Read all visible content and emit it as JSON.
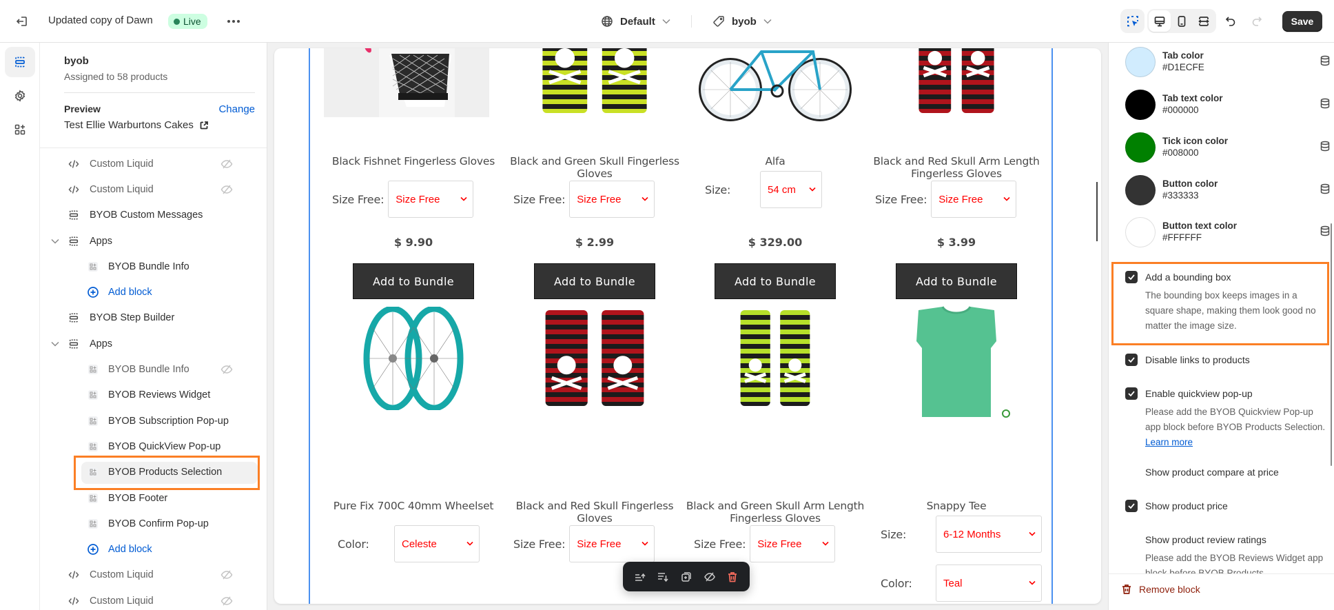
{
  "topbar": {
    "theme_name": "Updated copy of Dawn",
    "status_badge": "Live",
    "locale": "Default",
    "template": "byob",
    "save_label": "Save",
    "icons": [
      "exit-icon",
      "more-icon",
      "globe-icon",
      "tag-icon",
      "inspector-icon",
      "desktop-icon",
      "mobile-icon",
      "fullwidth-icon",
      "undo-icon",
      "redo-icon"
    ]
  },
  "rail": {
    "items": [
      {
        "name": "sections",
        "icon": "sections-icon",
        "active": true
      },
      {
        "name": "theme-settings",
        "icon": "gear-icon",
        "active": false
      },
      {
        "name": "app-embeds",
        "icon": "apps-icon",
        "active": false
      }
    ]
  },
  "sidebar": {
    "template_name": "byob",
    "assigned": "Assigned to 58 products",
    "preview_label": "Preview",
    "change_label": "Change",
    "preview_value": "Test Ellie Warburtons Cakes",
    "tree": [
      {
        "label": "Custom Liquid",
        "type": "liquid",
        "level": 0,
        "hidden": true
      },
      {
        "label": "Custom Liquid",
        "type": "liquid",
        "level": 0,
        "hidden": true
      },
      {
        "label": "BYOB Custom Messages",
        "type": "section",
        "level": 0,
        "hidden": false
      },
      {
        "label": "Apps",
        "type": "group",
        "level": 0,
        "expanded": true
      },
      {
        "label": "BYOB Bundle Info",
        "type": "app",
        "level": 1,
        "hidden": false
      },
      {
        "label": "Add block",
        "type": "add",
        "level": 1
      },
      {
        "label": "BYOB Step Builder",
        "type": "section",
        "level": 0,
        "hidden": false
      },
      {
        "label": "Apps",
        "type": "group",
        "level": 0,
        "expanded": true
      },
      {
        "label": "BYOB Bundle Info",
        "type": "app",
        "level": 1,
        "hidden": true
      },
      {
        "label": "BYOB Reviews Widget",
        "type": "app",
        "level": 1,
        "hidden": false
      },
      {
        "label": "BYOB Subscription Pop-up",
        "type": "app",
        "level": 1,
        "hidden": false
      },
      {
        "label": "BYOB QuickView Pop-up",
        "type": "app",
        "level": 1,
        "hidden": false
      },
      {
        "label": "BYOB Products Selection",
        "type": "app",
        "level": 1,
        "hidden": false,
        "selected": true
      },
      {
        "label": "BYOB Footer",
        "type": "app",
        "level": 1,
        "hidden": false
      },
      {
        "label": "BYOB Confirm Pop-up",
        "type": "app",
        "level": 1,
        "hidden": false
      },
      {
        "label": "Add block",
        "type": "add",
        "level": 1
      },
      {
        "label": "Custom Liquid",
        "type": "liquid",
        "level": 0,
        "hidden": true
      },
      {
        "label": "Custom Liquid",
        "type": "liquid",
        "level": 0,
        "hidden": true
      }
    ]
  },
  "preview": {
    "products": [
      {
        "name": "Black Fishnet Fingerless Gloves",
        "option_label": "Size Free:",
        "option_value": "Size Free",
        "price": "$ 9.90",
        "button": "Add to Bundle",
        "image": "fishnet-glove"
      },
      {
        "name": "Black and Green Skull Fingerless Gloves",
        "option_label": "Size Free:",
        "option_value": "Size Free",
        "price": "$ 2.99",
        "button": "Add to Bundle",
        "image": "green-skull-gloves"
      },
      {
        "name": "Alfa",
        "option_label": "Size:",
        "option_value": "54 cm",
        "price": "$ 329.00",
        "button": "Add to Bundle",
        "image": "bicycle"
      },
      {
        "name": "Black and Red Skull Arm Length Fingerless Gloves",
        "option_label": "Size Free:",
        "option_value": "Size Free",
        "price": "$ 3.99",
        "button": "Add to Bundle",
        "image": "red-skull-arm-gloves"
      },
      {
        "name": "Pure Fix 700C 40mm Wheelset",
        "option_label": "Color:",
        "option_value": "Celeste",
        "image": "wheelset"
      },
      {
        "name": "Black and Red Skull Fingerless Gloves",
        "option_label": "Size Free:",
        "option_value": "Size Free",
        "image": "red-skull-gloves"
      },
      {
        "name": "Black and Green Skull Arm Length Fingerless Gloves",
        "option_label": "Size Free:",
        "option_value": "Size Free",
        "image": "green-skull-arm-gloves"
      },
      {
        "name": "Snappy Tee",
        "option_label": "Size:",
        "option_value": "6-12 Months",
        "option2_label": "Color:",
        "option2_value": "Teal",
        "image": "teal-tee"
      }
    ],
    "floating_toolbar": [
      "move-up-icon",
      "move-down-icon",
      "duplicate-icon",
      "hide-icon",
      "delete-icon"
    ]
  },
  "settings": {
    "colors": [
      {
        "label": "Tab color",
        "hex": "#D1ECFE"
      },
      {
        "label": "Tab text color",
        "hex": "#000000"
      },
      {
        "label": "Tick icon color",
        "hex": "#008000"
      },
      {
        "label": "Button color",
        "hex": "#333333"
      },
      {
        "label": "Button text color",
        "hex": "#FFFFFF"
      }
    ],
    "checkboxes": [
      {
        "label": "Add a bounding box",
        "checked": true,
        "help": "The bounding box keeps images in a square shape, making them look good no matter the image size."
      },
      {
        "label": "Disable links to products",
        "checked": true
      },
      {
        "label": "Enable quickview pop-up",
        "checked": true,
        "help": "Please add the BYOB Quickview Pop-up app block before BYOB Products Selection.",
        "link": "Learn more"
      },
      {
        "label": "Show product compare at price",
        "checked": false
      },
      {
        "label": "Show product price",
        "checked": true
      },
      {
        "label": "Show product review ratings",
        "checked": false,
        "help": "Please add the BYOB Reviews Widget app block before BYOB Products"
      }
    ],
    "remove_label": "Remove block"
  },
  "theme_colors": {
    "accent_blue": "#005bd3",
    "highlight_orange": "#fb7f25",
    "live_green": "#29845a",
    "danger_red": "#8e1f0b",
    "select_text": "#ff0000",
    "section_outline": "#4a90f0"
  }
}
